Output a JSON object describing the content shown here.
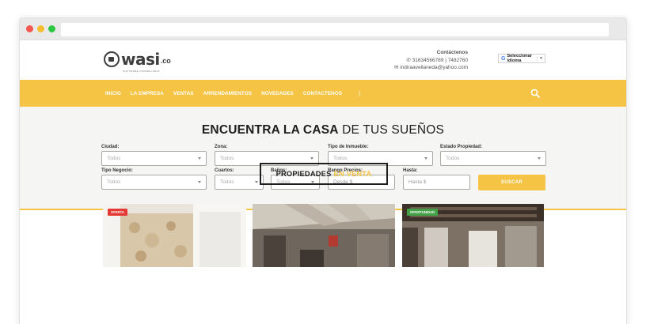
{
  "header": {
    "logo_text": "wasi",
    "logo_suffix": ".co",
    "logo_tagline": "SOFTWARE INMOBILIARIO",
    "contact_title": "Contáctenos",
    "phones": "31634566789 | 7482760",
    "email": "indiraavellaneda@yahoo.com",
    "translate_label": "Seleccionar idioma",
    "translate_arrow": "▼"
  },
  "nav": {
    "items": [
      "INICIO",
      "LA EMPRESA",
      "VENTAS",
      "ARRENDAMIENTOS",
      "NOVEDADES",
      "CONTACTENOS"
    ],
    "more": "⋮"
  },
  "hero": {
    "title_bold": "ENCUENTRA LA CASA",
    "title_rest": "DE TUS SUEÑOS"
  },
  "search": {
    "ciudad_label": "Ciudad:",
    "ciudad_value": "Todos",
    "zona_label": "Zona:",
    "zona_value": "Todos",
    "tipo_inmueble_label": "Tipo de Inmueble:",
    "tipo_inmueble_value": "Todos",
    "estado_label": "Estado Propiedad:",
    "estado_value": "Todos",
    "tipo_negocio_label": "Tipo Negocio:",
    "tipo_negocio_value": "Todos",
    "cuartos_label": "Cuartos:",
    "cuartos_value": "Todos",
    "banos_label": "Baños:",
    "banos_value": "Todos",
    "rango_label": "Rango Precios:",
    "desde_placeholder": "Desde $",
    "hasta_label": "Hasta:",
    "hasta_placeholder": "Hasta $",
    "submit_label": "SUSCAR"
  },
  "section": {
    "title_main": "PROPIEDADES",
    "title_accent": "EN VENTA"
  },
  "cards": [
    {
      "badge": "OFERTA",
      "badge_color": "#e53935"
    },
    {
      "badge": "",
      "badge_color": ""
    },
    {
      "badge": "OPORTUNIDAD",
      "badge_color": "#43a047"
    }
  ],
  "colors": {
    "accent": "#f5c445",
    "text_dark": "#1e1e1e"
  }
}
